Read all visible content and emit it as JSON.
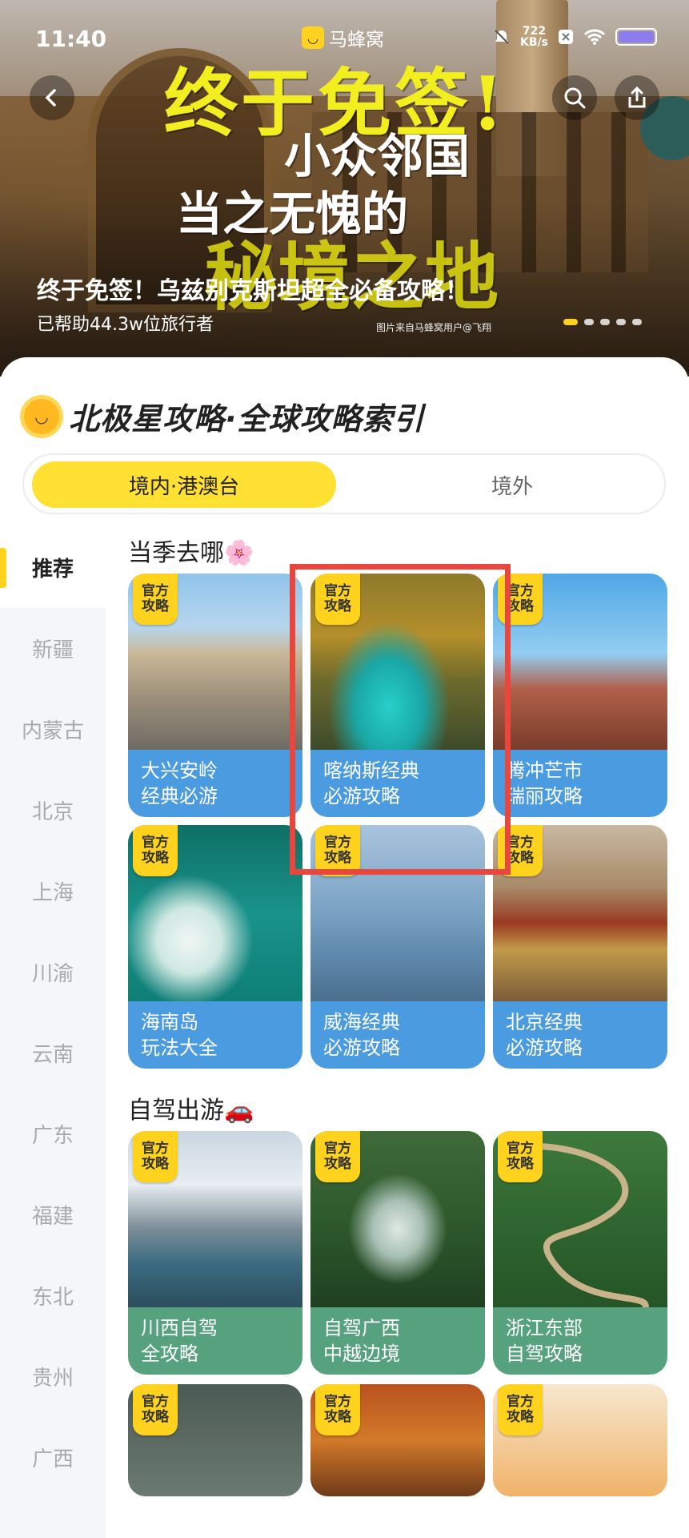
{
  "status": {
    "time": "11:40",
    "app_name": "马蜂窝",
    "net_speed": "722",
    "net_unit": "KB/s"
  },
  "hero": {
    "headline_1": "终于免签!",
    "headline_2": "小众邻国",
    "headline_3": "当之无愧的",
    "headline_4": "秘境之地",
    "title": "终于免签！乌兹别克斯坦超全必备攻略！",
    "subtitle": "已帮助44.3w位旅行者",
    "credit": "图片来自马蜂窝用户@飞翔",
    "page_count": 5,
    "active_page": 1
  },
  "section": {
    "title": "北极星攻略·全球攻略索引"
  },
  "tabs": {
    "domestic": "境内·港澳台",
    "abroad": "境外"
  },
  "sidebar": {
    "items": [
      "推荐",
      "新疆",
      "内蒙古",
      "北京",
      "上海",
      "川渝",
      "云南",
      "广东",
      "福建",
      "东北",
      "贵州",
      "广西"
    ]
  },
  "badge_text": {
    "line1": "官方",
    "line2": "攻略"
  },
  "season": {
    "title": "当季去哪🌸",
    "cards": [
      {
        "line1": "大兴安岭",
        "line2": "经典必游"
      },
      {
        "line1": "喀纳斯经典",
        "line2": "必游攻略"
      },
      {
        "line1": "腾冲芒市",
        "line2": "瑞丽攻略"
      },
      {
        "line1": "海南岛",
        "line2": "玩法大全"
      },
      {
        "line1": "威海经典",
        "line2": "必游攻略"
      },
      {
        "line1": "北京经典",
        "line2": "必游攻略"
      }
    ]
  },
  "selfdrive": {
    "title": "自驾出游🚗",
    "cards": [
      {
        "line1": "川西自驾",
        "line2": "全攻略"
      },
      {
        "line1": "自驾广西",
        "line2": "中越边境"
      },
      {
        "line1": "浙江东部",
        "line2": "自驾攻略"
      }
    ]
  },
  "colors": {
    "accent": "#ffd21e",
    "caption_blue": "#4a9be0",
    "caption_green": "#56a27e",
    "highlight": "#e9473d"
  }
}
